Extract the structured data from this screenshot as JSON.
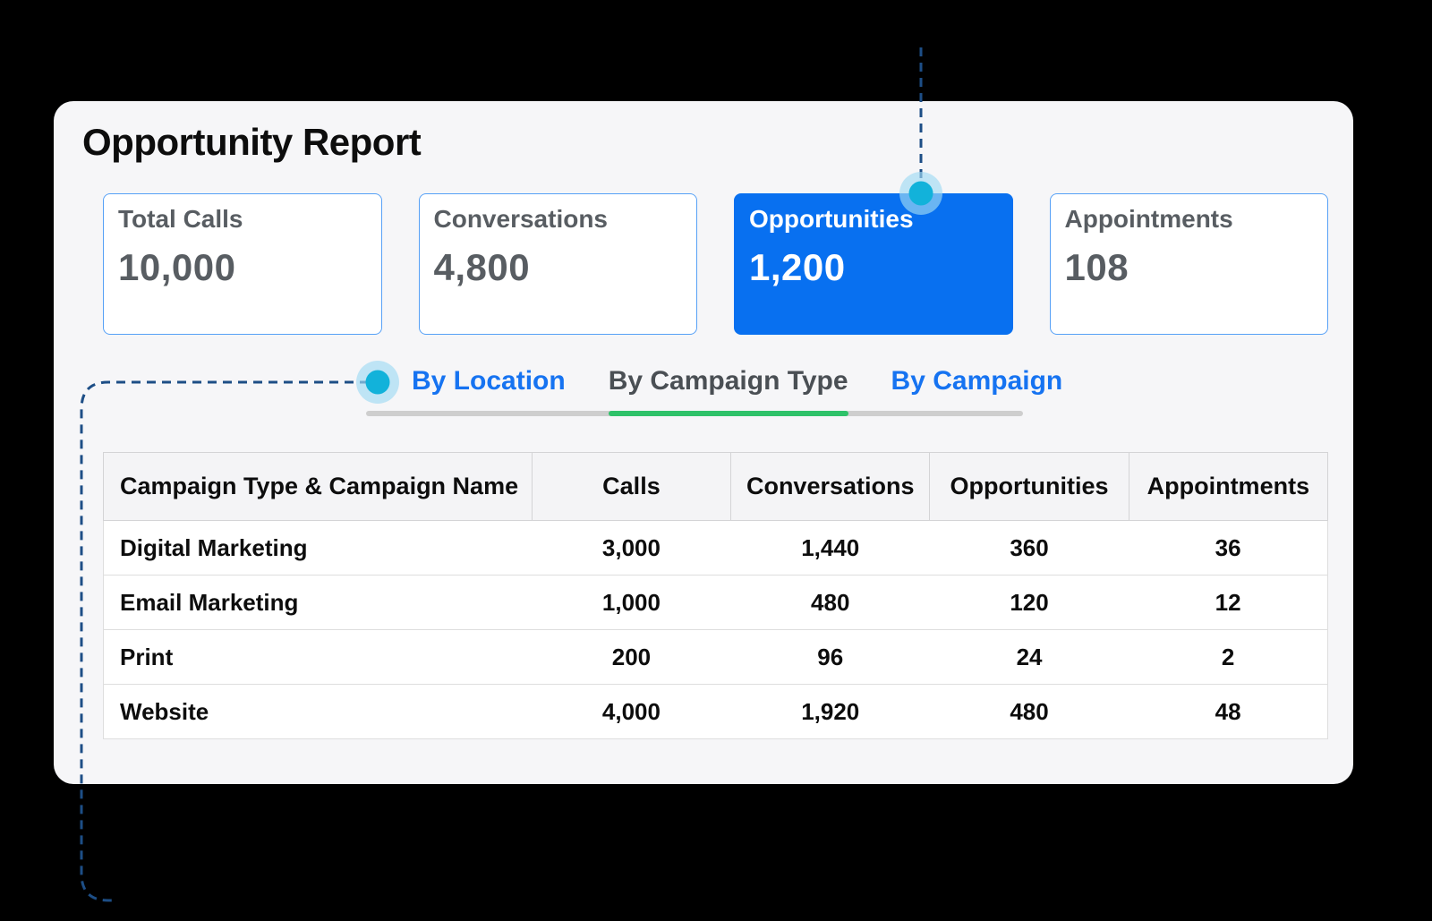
{
  "report": {
    "title": "Opportunity Report"
  },
  "stats": [
    {
      "label": "Total Calls",
      "value": "10,000",
      "highlighted": false
    },
    {
      "label": "Conversations",
      "value": "4,800",
      "highlighted": false
    },
    {
      "label": "Opportunities",
      "value": "1,200",
      "highlighted": true
    },
    {
      "label": "Appointments",
      "value": "108",
      "highlighted": false
    }
  ],
  "tabs": [
    {
      "label": "By Location",
      "active": false
    },
    {
      "label": "By Campaign Type",
      "active": true
    },
    {
      "label": "By Campaign",
      "active": false
    }
  ],
  "table": {
    "columns": [
      "Campaign Type & Campaign Name",
      "Calls",
      "Conversations",
      "Opportunities",
      "Appointments"
    ],
    "rows": [
      {
        "name": "Digital Marketing",
        "values": [
          "3,000",
          "1,440",
          "360",
          "36"
        ]
      },
      {
        "name": "Email Marketing",
        "values": [
          "1,000",
          "480",
          "120",
          "12"
        ]
      },
      {
        "name": "Print",
        "values": [
          "200",
          "96",
          "24",
          "2"
        ]
      },
      {
        "name": "Website",
        "values": [
          "4,000",
          "1,920",
          "480",
          "48"
        ]
      }
    ]
  },
  "colors": {
    "highlight_card_blue": "#0870f0",
    "stat_card_border_blue": "#57a1f6",
    "tab_link_blue": "#1673f1",
    "active_tab_gray": "#4a4f54",
    "tab_indicator_green": "#2ec269",
    "callout_line_navy": "#1d4e86",
    "callout_dot_cyan": "#12b2da",
    "panel_background": "#f6f6f8"
  }
}
